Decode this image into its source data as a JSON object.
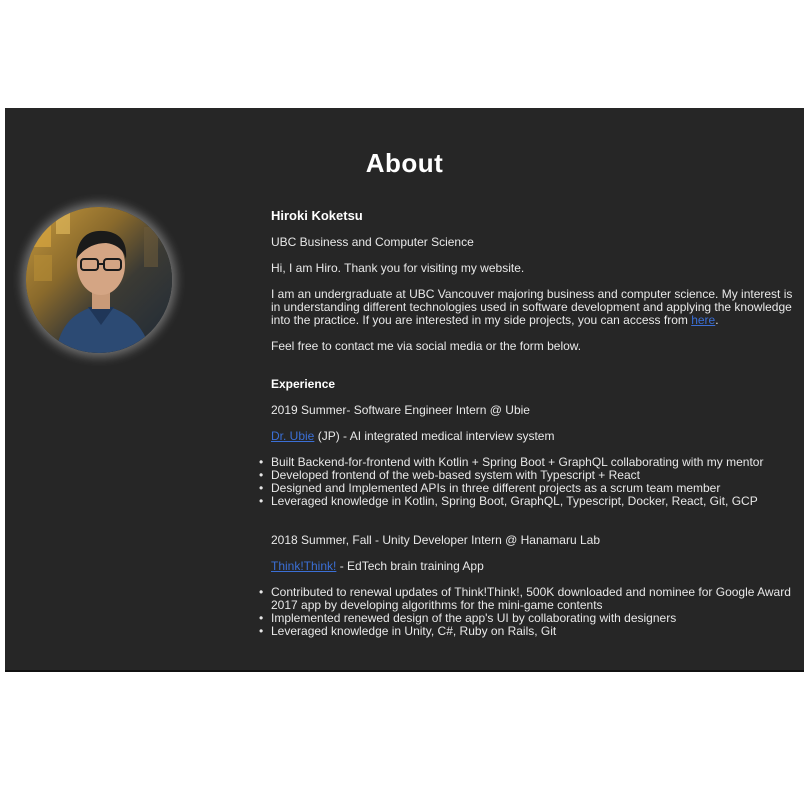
{
  "page": {
    "title": "About"
  },
  "profile": {
    "name": "Hiroki Koketsu",
    "program": "UBC Business and Computer Science",
    "greeting": "Hi, I am Hiro. Thank you for visiting my website.",
    "intro_text": "I am an undergraduate at UBC Vancouver majoring business and computer science. My interest is in understanding different technologies used in software development and applying the knowledge into the practice. If you are interested in my side projects, you can access from ",
    "intro_link": "here",
    "intro_end": ".",
    "contact": "Feel free to contact me via social media or the form below."
  },
  "experience": {
    "heading": "Experience",
    "jobs": [
      {
        "title": "2019 Summer- Software Engineer Intern @ Ubie",
        "product_link": "Dr. Ubie",
        "product_desc": " (JP) - AI integrated medical interview system",
        "bullets": [
          "Built Backend-for-frontend with Kotlin + Spring Boot + GraphQL collaborating with my mentor",
          "Developed frontend of the web-based system with Typescript + React",
          "Designed and Implemented APIs in three different projects as a scrum team member",
          "Leveraged knowledge in Kotlin, Spring Boot, GraphQL, Typescript, Docker, React, Git, GCP"
        ]
      },
      {
        "title": "2018 Summer, Fall - Unity Developer Intern @ Hanamaru Lab",
        "product_link": "Think!Think!",
        "product_desc": " - EdTech brain training App",
        "bullets": [
          "Contributed to renewal updates of Think!Think!, 500K downloaded and nominee for Google Award 2017 app by developing algorithms for the mini-game contents",
          "Implemented renewed design of the app's UI by collaborating with designers",
          "Leveraged knowledge in Unity, C#, Ruby on Rails, Git"
        ]
      }
    ]
  },
  "colors": {
    "panel_bg": "#262626",
    "link": "#3b6fd6",
    "text": "#e8e8e8"
  }
}
